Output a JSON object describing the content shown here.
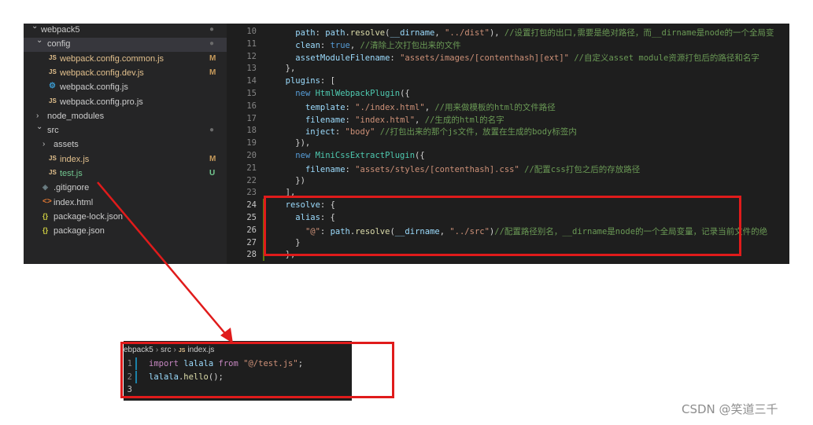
{
  "explorer": {
    "items": [
      {
        "chev": "v",
        "icon": "",
        "label": "webpack5",
        "status": "●",
        "status_kind": "dot",
        "indent": 0
      },
      {
        "chev": "v",
        "icon": "",
        "label": "config",
        "status": "●",
        "status_kind": "dot",
        "indent": 1,
        "selected": true
      },
      {
        "chev": "",
        "icon": "JS",
        "label": "webpack.config.common.js",
        "status": "M",
        "status_kind": "m",
        "indent": 2
      },
      {
        "chev": "",
        "icon": "JS",
        "label": "webpack.config.dev.js",
        "status": "M",
        "status_kind": "m",
        "indent": 2
      },
      {
        "chev": "",
        "icon": "⚙",
        "label": "webpack.config.js",
        "status": "",
        "status_kind": "",
        "indent": 2
      },
      {
        "chev": "",
        "icon": "JS",
        "label": "webpack.config.pro.js",
        "status": "",
        "status_kind": "",
        "indent": 2
      },
      {
        "chev": ">",
        "icon": "",
        "label": "node_modules",
        "status": "",
        "status_kind": "",
        "indent": 1
      },
      {
        "chev": "v",
        "icon": "",
        "label": "src",
        "status": "●",
        "status_kind": "dot",
        "indent": 1
      },
      {
        "chev": ">",
        "icon": "",
        "label": "assets",
        "status": "",
        "status_kind": "",
        "indent": 2
      },
      {
        "chev": "",
        "icon": "JS",
        "label": "index.js",
        "status": "M",
        "status_kind": "m",
        "indent": 2
      },
      {
        "chev": "",
        "icon": "JS",
        "label": "test.js",
        "status": "U",
        "status_kind": "u",
        "indent": 2
      },
      {
        "chev": "",
        "icon": "◈",
        "label": ".gitignore",
        "status": "",
        "status_kind": "",
        "indent": 1
      },
      {
        "chev": "",
        "icon": "<>",
        "label": "index.html",
        "status": "",
        "status_kind": "",
        "indent": 1
      },
      {
        "chev": "",
        "icon": "{}",
        "label": "package-lock.json",
        "status": "",
        "status_kind": "",
        "indent": 1
      },
      {
        "chev": "",
        "icon": "{}",
        "label": "package.json",
        "status": "",
        "status_kind": "",
        "indent": 1
      }
    ]
  },
  "editor_top": {
    "lines": [
      {
        "n": "10",
        "tokens": [
          [
            "w",
            "    "
          ],
          [
            "p",
            "path"
          ],
          [
            "w",
            ": "
          ],
          [
            "p",
            "path"
          ],
          [
            "w",
            "."
          ],
          [
            "f",
            "resolve"
          ],
          [
            "w",
            "("
          ],
          [
            "p",
            "__dirname"
          ],
          [
            "w",
            ", "
          ],
          [
            "s",
            "\"../dist\""
          ],
          [
            "w",
            "), "
          ],
          [
            "c",
            "//设置打包的出口,需要是绝对路径，而__dirname是node的一个全局变"
          ]
        ]
      },
      {
        "n": "11",
        "tokens": [
          [
            "w",
            "    "
          ],
          [
            "p",
            "clean"
          ],
          [
            "w",
            ": "
          ],
          [
            "k",
            "true"
          ],
          [
            "w",
            ", "
          ],
          [
            "c",
            "//清除上次打包出来的文件"
          ]
        ]
      },
      {
        "n": "12",
        "tokens": [
          [
            "w",
            "    "
          ],
          [
            "p",
            "assetModuleFilename"
          ],
          [
            "w",
            ": "
          ],
          [
            "s",
            "\"assets/images/[contenthash][ext]\""
          ],
          [
            "w",
            " "
          ],
          [
            "c",
            "//自定义asset module资源打包后的路径和名字"
          ]
        ]
      },
      {
        "n": "13",
        "tokens": [
          [
            "w",
            "  },"
          ]
        ]
      },
      {
        "n": "14",
        "tokens": [
          [
            "w",
            "  "
          ],
          [
            "p",
            "plugins"
          ],
          [
            "w",
            ": ["
          ]
        ]
      },
      {
        "n": "15",
        "tokens": [
          [
            "w",
            "    "
          ],
          [
            "k",
            "new"
          ],
          [
            "w",
            " "
          ],
          [
            "t",
            "HtmlWebpackPlugin"
          ],
          [
            "w",
            "({"
          ]
        ]
      },
      {
        "n": "16",
        "tokens": [
          [
            "w",
            "      "
          ],
          [
            "p",
            "template"
          ],
          [
            "w",
            ": "
          ],
          [
            "s",
            "\"./index.html\""
          ],
          [
            "w",
            ", "
          ],
          [
            "c",
            "//用来做模板的html的文件路径"
          ]
        ]
      },
      {
        "n": "17",
        "tokens": [
          [
            "w",
            "      "
          ],
          [
            "p",
            "filename"
          ],
          [
            "w",
            ": "
          ],
          [
            "s",
            "\"index.html\""
          ],
          [
            "w",
            ", "
          ],
          [
            "c",
            "//生成的html的名字"
          ]
        ]
      },
      {
        "n": "18",
        "tokens": [
          [
            "w",
            "      "
          ],
          [
            "p",
            "inject"
          ],
          [
            "w",
            ": "
          ],
          [
            "s",
            "\"body\""
          ],
          [
            "w",
            " "
          ],
          [
            "c",
            "//打包出来的那个js文件，放置在生成的body标签内"
          ]
        ]
      },
      {
        "n": "19",
        "tokens": [
          [
            "w",
            "    }),"
          ]
        ]
      },
      {
        "n": "20",
        "tokens": [
          [
            "w",
            "    "
          ],
          [
            "k",
            "new"
          ],
          [
            "w",
            " "
          ],
          [
            "t",
            "MiniCssExtractPlugin"
          ],
          [
            "w",
            "({"
          ]
        ]
      },
      {
        "n": "21",
        "tokens": [
          [
            "w",
            "      "
          ],
          [
            "p",
            "filename"
          ],
          [
            "w",
            ": "
          ],
          [
            "s",
            "\"assets/styles/[contenthash].css\""
          ],
          [
            "w",
            " "
          ],
          [
            "c",
            "//配置css打包之后的存放路径"
          ]
        ]
      },
      {
        "n": "22",
        "tokens": [
          [
            "w",
            "    })"
          ]
        ]
      },
      {
        "n": "23",
        "tokens": [
          [
            "w",
            "  ],"
          ]
        ]
      },
      {
        "n": "24",
        "active": true,
        "tokens": [
          [
            "w",
            "  "
          ],
          [
            "p",
            "resolve"
          ],
          [
            "w",
            ": {"
          ]
        ]
      },
      {
        "n": "25",
        "active": true,
        "tokens": [
          [
            "w",
            "    "
          ],
          [
            "p",
            "alias"
          ],
          [
            "w",
            ": {"
          ]
        ]
      },
      {
        "n": "26",
        "active": true,
        "tokens": [
          [
            "w",
            "      "
          ],
          [
            "s",
            "\"@\""
          ],
          [
            "w",
            ": "
          ],
          [
            "p",
            "path"
          ],
          [
            "w",
            "."
          ],
          [
            "f",
            "resolve"
          ],
          [
            "w",
            "("
          ],
          [
            "p",
            "__dirname"
          ],
          [
            "w",
            ", "
          ],
          [
            "s",
            "\"../src\""
          ],
          [
            "w",
            ")"
          ],
          [
            "c",
            "//配置路径别名，__dirname是node的一个全局变量，记录当前文件的绝"
          ]
        ]
      },
      {
        "n": "27",
        "active": true,
        "tokens": [
          [
            "w",
            "    }"
          ]
        ]
      },
      {
        "n": "28",
        "active": true,
        "tokens": [
          [
            "w",
            "  },"
          ]
        ]
      }
    ]
  },
  "editor_bottom": {
    "breadcrumb": {
      "root": "ebpack5",
      "folder": "src",
      "file_badge": "JS",
      "file": "index.js"
    },
    "lines": [
      {
        "n": "1",
        "tokens": [
          [
            "k2",
            "import"
          ],
          [
            "w",
            " "
          ],
          [
            "p",
            "lalala"
          ],
          [
            "w",
            " "
          ],
          [
            "k2",
            "from"
          ],
          [
            "w",
            " "
          ],
          [
            "s",
            "\"@/test.js\""
          ],
          [
            "w",
            ";"
          ]
        ]
      },
      {
        "n": "2",
        "tokens": [
          [
            "p",
            "lalala"
          ],
          [
            "w",
            "."
          ],
          [
            "f",
            "hello"
          ],
          [
            "w",
            "();"
          ]
        ]
      },
      {
        "n": "3",
        "active": true,
        "tokens": []
      }
    ]
  },
  "watermark": "CSDN @笑道三千",
  "colors": {
    "annotation_red": "#e01b1b",
    "editor_bg": "#1e1e1e",
    "sidebar_bg": "#252526"
  }
}
